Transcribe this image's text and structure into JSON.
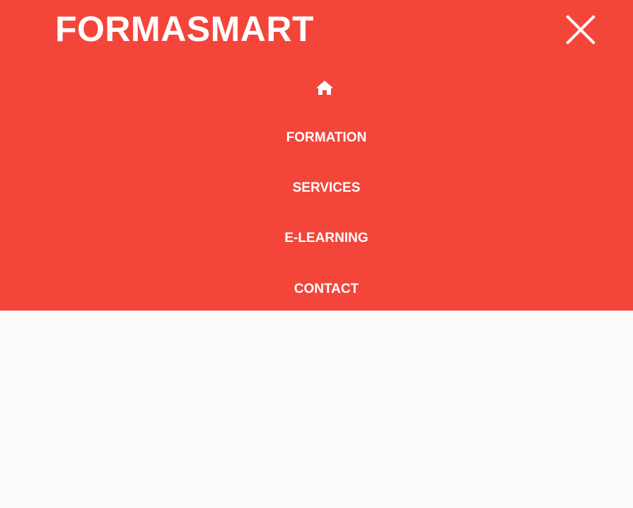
{
  "header": {
    "brand": "FORMASMART",
    "close_icon": "close-icon"
  },
  "nav": {
    "home_icon": "home-icon",
    "items": [
      {
        "label": "FORMATION"
      },
      {
        "label": "SERVICES"
      },
      {
        "label": "E-LEARNING"
      },
      {
        "label": "CONTACT"
      }
    ]
  },
  "colors": {
    "menu_background": "#f4453a",
    "text": "#ffffff",
    "page_background": "#fcfcfc"
  }
}
